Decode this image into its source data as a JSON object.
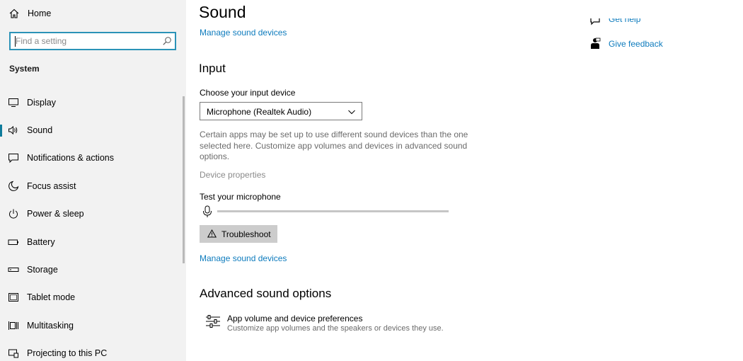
{
  "sidebar": {
    "home_label": "Home",
    "search_placeholder": "Find a setting",
    "section_label": "System",
    "items": [
      {
        "label": "Display",
        "icon": "display-icon"
      },
      {
        "label": "Sound",
        "icon": "speaker-icon",
        "selected": true
      },
      {
        "label": "Notifications & actions",
        "icon": "notification-icon"
      },
      {
        "label": "Focus assist",
        "icon": "moon-icon"
      },
      {
        "label": "Power & sleep",
        "icon": "power-icon"
      },
      {
        "label": "Battery",
        "icon": "battery-icon"
      },
      {
        "label": "Storage",
        "icon": "storage-icon"
      },
      {
        "label": "Tablet mode",
        "icon": "tablet-icon"
      },
      {
        "label": "Multitasking",
        "icon": "multitasking-icon"
      },
      {
        "label": "Projecting to this PC",
        "icon": "projecting-icon"
      }
    ]
  },
  "main": {
    "title": "Sound",
    "manage_link_top": "Manage sound devices",
    "input_heading": "Input",
    "choose_label": "Choose your input device",
    "device_selected": "Microphone (Realtek Audio)",
    "description": "Certain apps may be set up to use different sound devices than the one selected here. Customize app volumes and devices in advanced sound options.",
    "device_properties": "Device properties",
    "test_label": "Test your microphone",
    "troubleshoot_label": "Troubleshoot",
    "manage_link_bottom": "Manage sound devices",
    "advanced_heading": "Advanced sound options",
    "app_volume_title": "App volume and device preferences",
    "app_volume_sub": "Customize app volumes and the speakers or devices they use."
  },
  "related": {
    "get_help": "Get help",
    "give_feedback": "Give feedback"
  },
  "colors": {
    "accent": "#0d7bbd",
    "selection_indicator": "#0f7c9b",
    "search_border": "#2b93b7",
    "sidebar_bg": "#f2f2f2"
  }
}
